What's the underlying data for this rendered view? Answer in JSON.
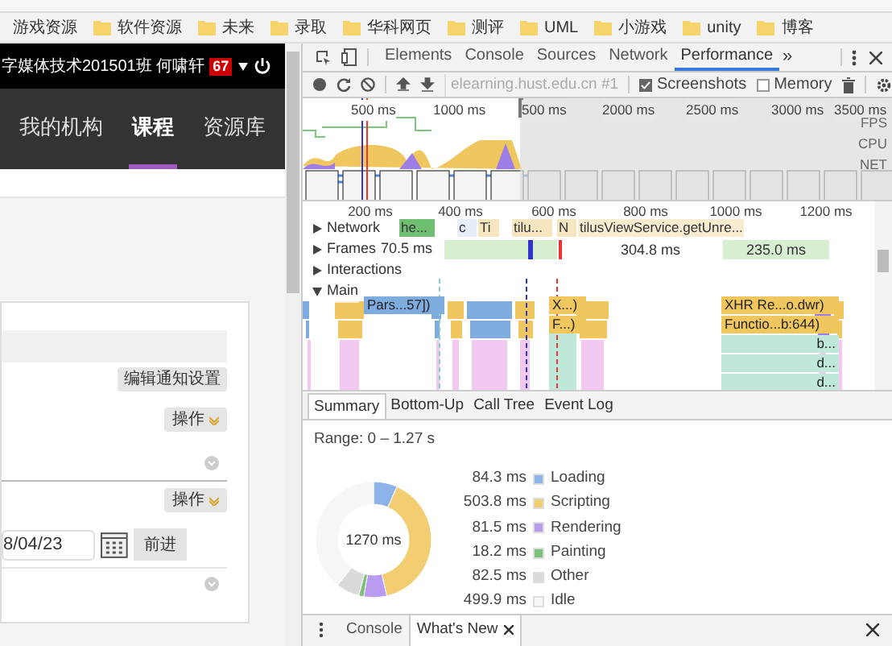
{
  "bookmarks": [
    {
      "label": "游戏资源"
    },
    {
      "label": "软件资源"
    },
    {
      "label": "未来"
    },
    {
      "label": "录取"
    },
    {
      "label": "华科网页"
    },
    {
      "label": "测评"
    },
    {
      "label": "UML"
    },
    {
      "label": "小游戏"
    },
    {
      "label": "unity"
    },
    {
      "label": "博客"
    }
  ],
  "page": {
    "user": "字媒体技术201501班 何啸轩",
    "badge": "67",
    "nav": [
      {
        "label": "我的机构",
        "selected": false
      },
      {
        "label": "课程",
        "selected": true
      },
      {
        "label": "资源库",
        "selected": false
      }
    ],
    "notify_button": "编辑通知设置",
    "action_buttons": [
      "操作",
      "操作"
    ],
    "date_value": "8/04/23",
    "go_button": "前进"
  },
  "devtools": {
    "tabs": [
      {
        "label": "Elements",
        "selected": false
      },
      {
        "label": "Console",
        "selected": false
      },
      {
        "label": "Sources",
        "selected": false
      },
      {
        "label": "Network",
        "selected": false
      },
      {
        "label": "Performance",
        "selected": true
      }
    ],
    "more_tabs": "»",
    "target": "elearning.hust.edu.cn #1",
    "options": [
      {
        "label": "Screenshots",
        "checked": true
      },
      {
        "label": "Memory",
        "checked": false
      }
    ],
    "overview_ticks": [
      "500 ms",
      "1000 ms",
      "500 ms",
      "2000 ms",
      "2500 ms",
      "3000 ms",
      "3500 ms"
    ],
    "overview_lanes": [
      "FPS",
      "CPU",
      "NET"
    ],
    "ruler": [
      "200 ms",
      "400 ms",
      "600 ms",
      "800 ms",
      "1000 ms",
      "1200 ms"
    ],
    "tracks": [
      {
        "label": "Network",
        "expanded": false
      },
      {
        "label": "Frames",
        "expanded": false
      },
      {
        "label": "Interactions",
        "expanded": false
      },
      {
        "label": "Main",
        "expanded": true
      }
    ],
    "first_frame": "70.5 ms",
    "frames": [
      "304.8 ms",
      "235.0 ms"
    ],
    "network_requests": [
      {
        "text": "he...",
        "color": "#6fbf73"
      },
      {
        "text": "c",
        "color": "#e8eef8"
      },
      {
        "text": "Ti",
        "color": "#f5e6c0"
      },
      {
        "text": "tilu...",
        "color": "#f5e6c0"
      },
      {
        "text": "N",
        "color": "#f5e6c0"
      },
      {
        "text": "tilusViewService.getUnre...",
        "color": "#f8ecd0"
      }
    ],
    "main_events": [
      {
        "text": "Pars...57])",
        "color": "#7facdf"
      },
      {
        "text": "X...)",
        "color": "#f0c75e"
      },
      {
        "text": "F...)",
        "color": "#f0c75e"
      },
      {
        "text": "XHR Re...o.dwr)",
        "color": "#f0c75e"
      },
      {
        "text": "Functio...b:644)",
        "color": "#f0c75e"
      },
      {
        "text": "b...",
        "color": "#bfe8d8"
      },
      {
        "text": "d...",
        "color": "#bfe8d8"
      },
      {
        "text": "d...",
        "color": "#bfe8d8"
      }
    ],
    "summary_tabs": [
      {
        "label": "Summary",
        "selected": true
      },
      {
        "label": "Bottom-Up",
        "selected": false
      },
      {
        "label": "Call Tree",
        "selected": false
      },
      {
        "label": "Event Log",
        "selected": false
      }
    ],
    "range": "Range: 0 – 1.27 s",
    "total": "1270 ms",
    "legend": [
      {
        "value": "84.3 ms",
        "color": "#8db4e8"
      },
      {
        "value": "503.8 ms",
        "color": "#f2cd72"
      },
      {
        "value": "81.5 ms",
        "color": "#b99cf0"
      },
      {
        "value": "18.2 ms",
        "color": "#7cbf7c"
      },
      {
        "value": "82.5 ms",
        "color": "#dadada"
      },
      {
        "value": "499.9 ms",
        "color": "#f6f6f6"
      }
    ],
    "chart_data": {
      "type": "donut",
      "categories": [
        "Loading",
        "Scripting",
        "Rendering",
        "Painting",
        "Other",
        "Idle"
      ],
      "values": [
        6.64,
        39.66,
        6.42,
        1.43,
        6.5,
        39.35
      ]
    },
    "drawer_tabs": [
      {
        "label": "Console",
        "selected": false,
        "closable": false
      },
      {
        "label": "What's New",
        "selected": true,
        "closable": true
      }
    ]
  }
}
